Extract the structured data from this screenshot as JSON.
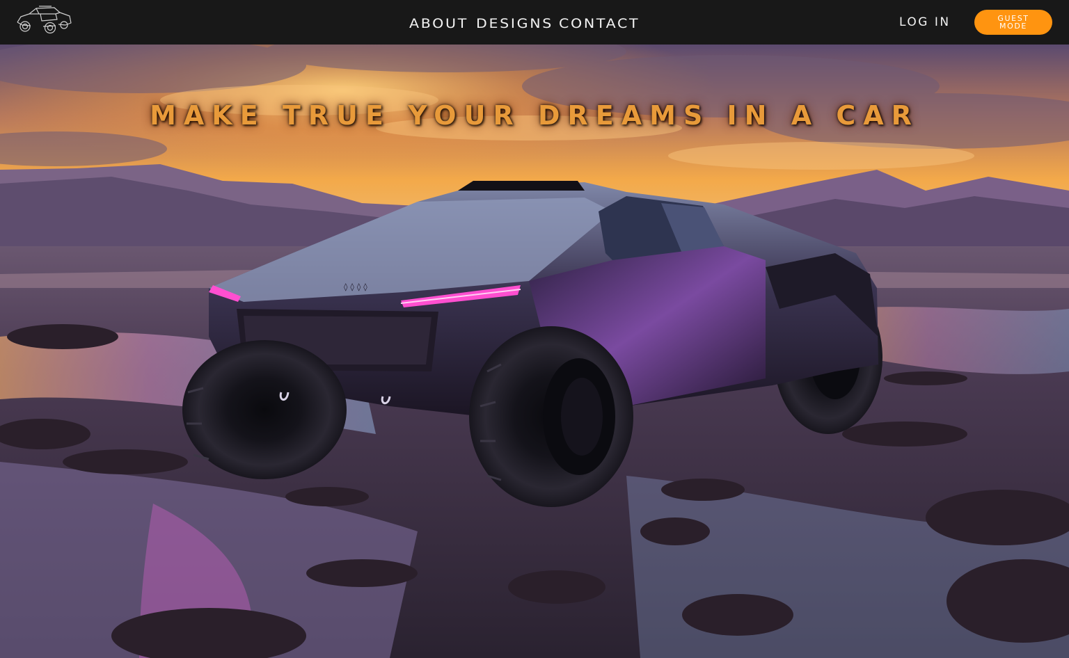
{
  "header": {
    "logo_icon": "offroad-car-logo-icon",
    "nav": [
      {
        "label": "ABOUT"
      },
      {
        "label": "DESIGNS"
      },
      {
        "label": "CONTACT"
      }
    ],
    "login_label": "LOG IN",
    "guest_label": "GUEST\nMODE"
  },
  "hero": {
    "headline": "MAKE TRUE YOUR DREAMS IN A CAR",
    "image_icon": "futuristic-offroad-truck-image"
  },
  "colors": {
    "accent": "#ff9410",
    "topbar": "#181818",
    "headline": "#e89a3a",
    "car_light": "#ff4fd0"
  }
}
